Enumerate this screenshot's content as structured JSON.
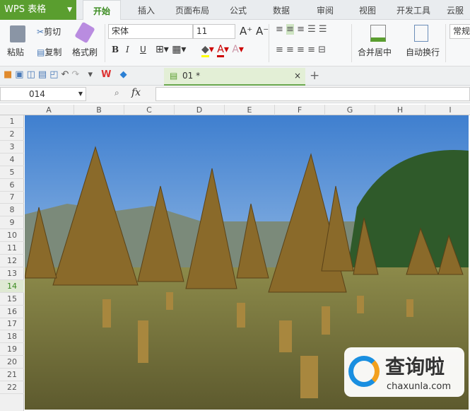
{
  "app": {
    "logo": "WPS 表格"
  },
  "tabs": [
    "开始",
    "插入",
    "页面布局",
    "公式",
    "数据",
    "审阅",
    "视图",
    "开发工具",
    "云服务"
  ],
  "ribbon": {
    "paste": "粘贴",
    "cut": "剪切",
    "copy": "复制",
    "format_painter": "格式刷",
    "font": "宋体",
    "font_size": "11",
    "bold": "B",
    "italic": "I",
    "underline": "U",
    "merge_center": "合并居中",
    "wrap_text": "自动换行",
    "number_format": "常规"
  },
  "document_tab": {
    "name": "01 *",
    "close": "×",
    "new": "+"
  },
  "formula_bar": {
    "cell_ref": "014",
    "fx": "fx",
    "value": ""
  },
  "columns": [
    "A",
    "B",
    "C",
    "D",
    "E",
    "F",
    "G",
    "H",
    "I"
  ],
  "rows": [
    "1",
    "2",
    "3",
    "4",
    "5",
    "6",
    "7",
    "8",
    "9",
    "10",
    "11",
    "12",
    "13",
    "14",
    "15",
    "16",
    "17",
    "18",
    "19",
    "20",
    "21",
    "22"
  ],
  "selected_row": "14",
  "watermark": {
    "name": "查询啦",
    "url": "chaxunla.com"
  },
  "colors": {
    "accent": "#5a9e2f"
  }
}
